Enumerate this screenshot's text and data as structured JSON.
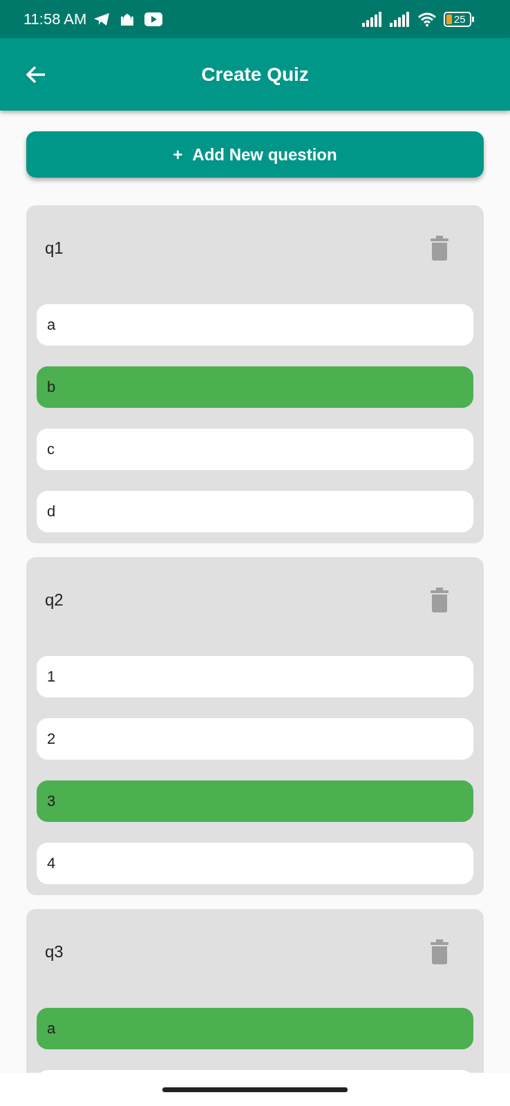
{
  "status_bar": {
    "time": "11:58 AM",
    "battery": "25"
  },
  "app_bar": {
    "title": "Create Quiz"
  },
  "add_button": {
    "icon": "+",
    "label": "Add New question"
  },
  "questions": [
    {
      "text": "q1",
      "options": [
        {
          "text": "a",
          "selected": false
        },
        {
          "text": "b",
          "selected": true
        },
        {
          "text": "c",
          "selected": false
        },
        {
          "text": "d",
          "selected": false
        }
      ]
    },
    {
      "text": "q2",
      "options": [
        {
          "text": "1",
          "selected": false
        },
        {
          "text": "2",
          "selected": false
        },
        {
          "text": "3",
          "selected": true
        },
        {
          "text": "4",
          "selected": false
        }
      ]
    },
    {
      "text": "q3",
      "options": [
        {
          "text": "a",
          "selected": true
        },
        {
          "selected": false
        }
      ]
    }
  ]
}
